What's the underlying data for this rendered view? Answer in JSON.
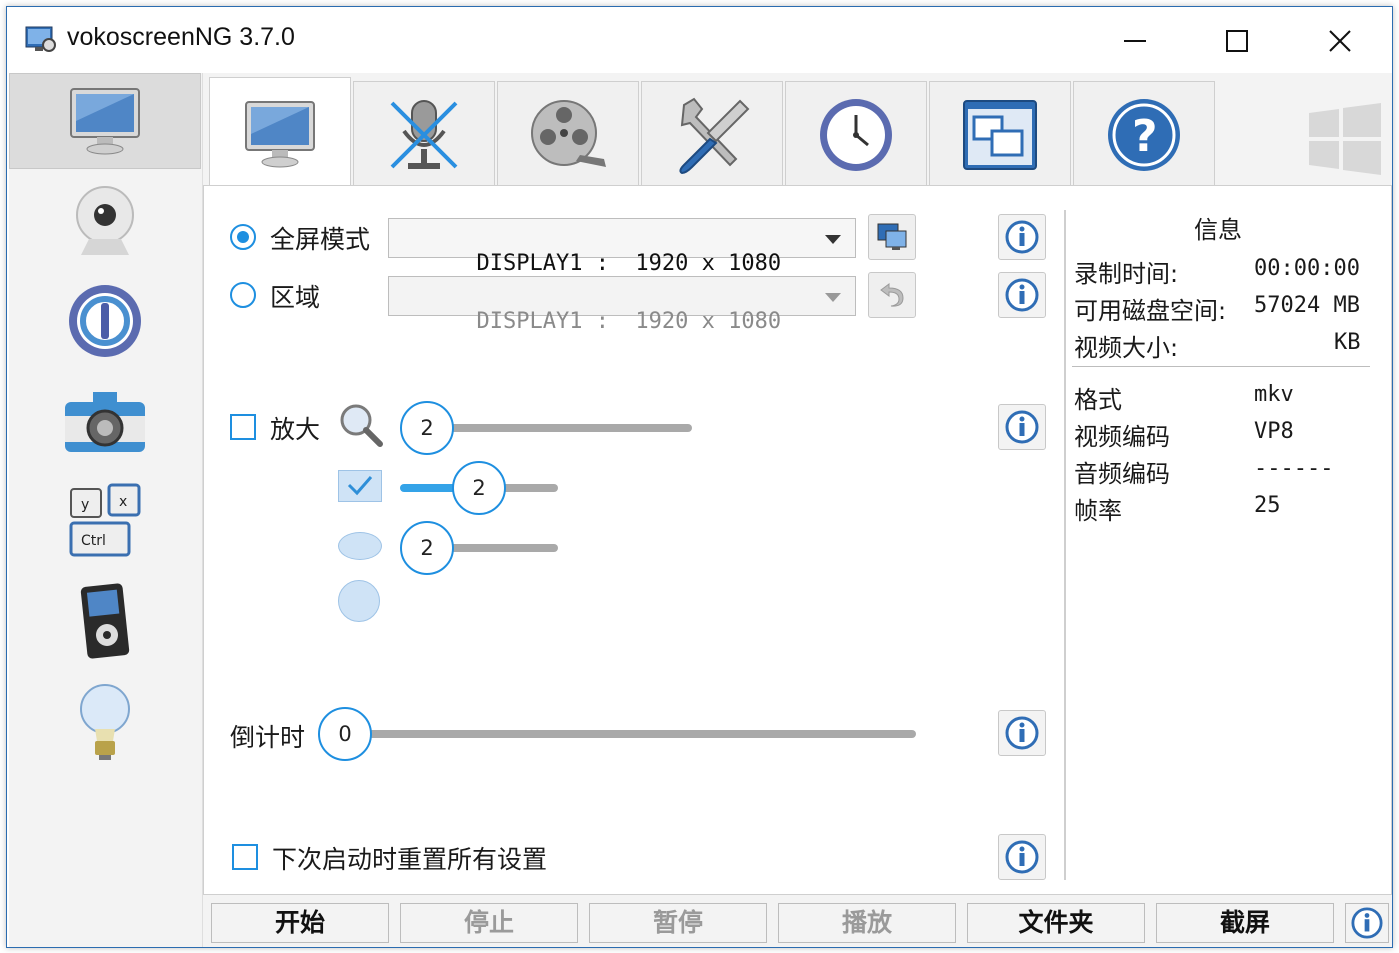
{
  "window": {
    "title": "vokoscreenNG 3.7.0",
    "accent": "#1e8fe0"
  },
  "titlebar": {
    "minimize_icon": "minimize-icon",
    "maximize_icon": "maximize-icon",
    "close_icon": "close-icon"
  },
  "sidebar": {
    "items": [
      {
        "icon": "monitor-icon",
        "active": true
      },
      {
        "icon": "webcam-icon"
      },
      {
        "icon": "player-ring-icon"
      },
      {
        "icon": "camera-icon"
      },
      {
        "icon": "keyboard-shortcut-icon"
      },
      {
        "icon": "media-player-icon"
      },
      {
        "icon": "lightbulb-icon"
      }
    ]
  },
  "tabs": [
    {
      "icon": "monitor-icon",
      "active": true
    },
    {
      "icon": "microphone-muted-icon"
    },
    {
      "icon": "film-reel-icon"
    },
    {
      "icon": "tools-icon"
    },
    {
      "icon": "clock-icon"
    },
    {
      "icon": "windows-icon"
    },
    {
      "icon": "help-icon"
    }
  ],
  "screen": {
    "fullscreen_label": "全屏模式",
    "fullscreen_value": "DISPLAY1 :  1920 x 1080",
    "area_label": "区域",
    "area_value": "DISPLAY1 :  1920 x 1080",
    "magnifier_label": "放大",
    "magnifier_level": 2,
    "magnifier_width": 2,
    "magnifier_height": 2,
    "countdown_label": "倒计时",
    "countdown_value": 0,
    "reset_label": "下次启动时重置所有设置"
  },
  "info": {
    "title": "信息",
    "rows": [
      {
        "label": "录制时间:",
        "value": "00:00:00"
      },
      {
        "label": "可用磁盘空间:",
        "value": "57024 MB"
      },
      {
        "label": "视频大小:",
        "value": "KB"
      }
    ],
    "format_rows": [
      {
        "label": "格式",
        "value": "mkv"
      },
      {
        "label": "视频编码",
        "value": "VP8"
      },
      {
        "label": "音频编码",
        "value": "------"
      },
      {
        "label": "帧率",
        "value": "25"
      }
    ]
  },
  "bottom": {
    "start": "开始",
    "stop": "停止",
    "pause": "暂停",
    "play": "播放",
    "folder": "文件夹",
    "screenshot": "截屏"
  }
}
